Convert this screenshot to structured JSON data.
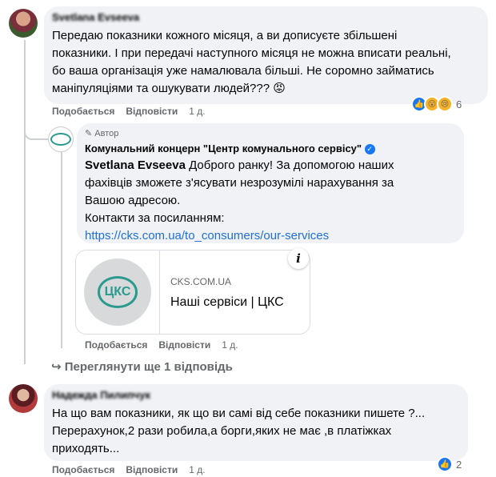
{
  "comments": [
    {
      "author": "Svetlana Evseeva",
      "text": "Передаю показники кожного місяця, а ви дописуєте збільшені показники. І при передачі наступного місяця не можна вписати реальні, бо ваша організація уже намалювала більші. Не соромно займатись маніпуляціями та ошукувати людей???",
      "emoji": "😡",
      "like": "Подобається",
      "reply": "Відповісти",
      "time": "1 д.",
      "reaction_count": "6"
    },
    {
      "author_badge": "Автор",
      "author": "Комунальний концерн \"Центр комунального сервісу\"",
      "mention": "Svetlana Evseeva",
      "text": " Доброго ранку! За допомогою наших фахівців зможете з'ясувати незрозумілі нарахування за Вашою адресою.",
      "contacts": "Контакти за посиланням:",
      "link": "https://cks.com.ua/to_consumers/our-services",
      "preview": {
        "domain": "CKS.COM.UA",
        "title": "Наші сервіси | ЦКС",
        "logo_text": "ЦКС"
      },
      "like": "Подобається",
      "reply": "Відповісти",
      "time": "1 д."
    },
    {
      "author": "Надежда Пилипчук",
      "text": "На що вам показники, як що ви самі від себе показники пишете ?... Перерахунок,2 рази робила,а борги,яких не має ,в платіжках приходять...",
      "like": "Подобається",
      "reply": "Відповісти",
      "time": "1 д.",
      "reaction_count": "2"
    }
  ],
  "more_replies": "Переглянути ще 1 відповідь",
  "colors": {
    "link": "#216fdb",
    "like_blue": "#1877f2",
    "bubble": "#f0f2f5"
  }
}
